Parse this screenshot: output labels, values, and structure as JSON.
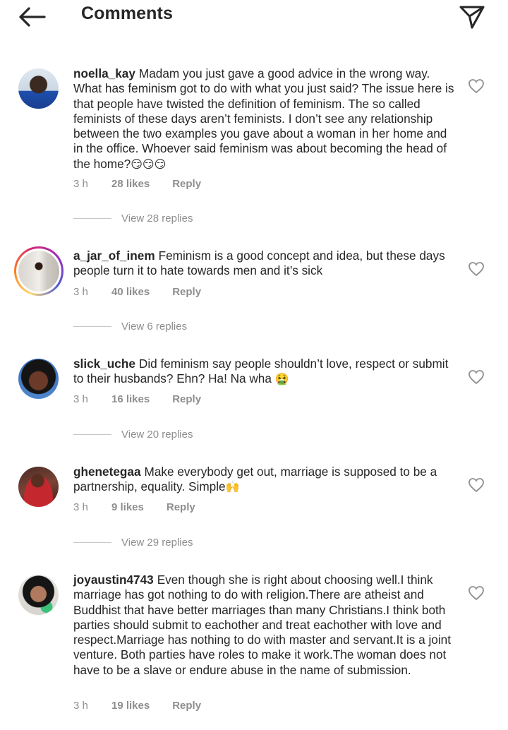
{
  "header": {
    "title": "Comments",
    "back_icon": "arrow-left-icon",
    "send_icon": "paper-plane-icon"
  },
  "colors": {
    "text": "#262626",
    "muted": "#8e8e8e",
    "divider": "#c7c7c7"
  },
  "comments": [
    {
      "username": "noella_kay",
      "text": "Madam you just gave a good advice in the wrong way. What has feminism got to do with what you just said? The issue here is that people have twisted the definition of feminism. The so called feminists of these days aren’t feminists. I don’t see any relationship between the two examples you gave about a woman in her home and in the office. Whoever said feminism was about becoming the head of the home?",
      "emoji": "😏😏😏",
      "time": "3 h",
      "likes": "28 likes",
      "reply": "Reply",
      "view_replies": "View 28 replies"
    },
    {
      "username": "a_jar_of_inem",
      "text": "Feminism is a good concept and idea, but these days people turn it to hate towards men and it’s sick",
      "emoji": "",
      "time": "3 h",
      "likes": "40 likes",
      "reply": "Reply",
      "view_replies": "View 6 replies"
    },
    {
      "username": "slick_uche",
      "text": "Did feminism say people shouldn’t love, respect or submit to their husbands? Ehn? Ha! Na wha",
      "emoji": "🤮",
      "time": "3 h",
      "likes": "16 likes",
      "reply": "Reply",
      "view_replies": "View 20 replies"
    },
    {
      "username": "ghenetegaa",
      "text": "Make everybody get out, marriage is supposed to be a partnership, equality. Simple",
      "emoji": "🙌",
      "time": "3 h",
      "likes": "9 likes",
      "reply": "Reply",
      "view_replies": "View 29 replies"
    },
    {
      "username": "joyaustin4743",
      "text": "Even though she is right about choosing well.I think marriage has got nothing to do with religion.There are atheist and Buddhist that have better marriages than many Christians.I think both parties should submit to eachother and treat eachother with love and respect.Marriage has nothing to do with master and servant.It is a joint venture. Both parties have roles to make it work.The woman does not have to be a slave or endure abuse in the name of submission.",
      "emoji": "",
      "time": "3 h",
      "likes": "19 likes",
      "reply": "Reply"
    }
  ]
}
